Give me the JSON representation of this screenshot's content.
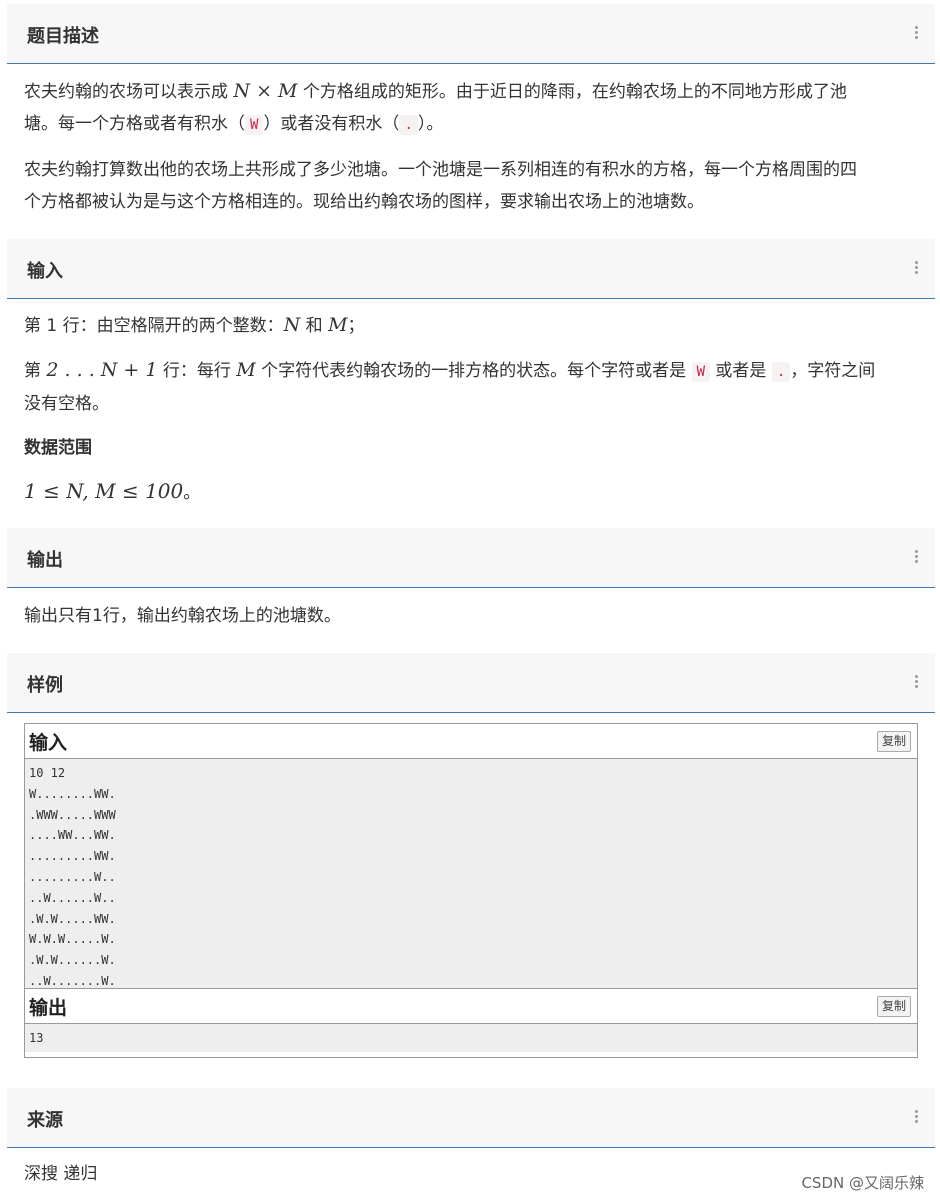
{
  "sections": {
    "description": {
      "title": "题目描述"
    },
    "input": {
      "title": "输入"
    },
    "output": {
      "title": "输出"
    },
    "sample": {
      "title": "样例"
    },
    "source": {
      "title": "来源"
    }
  },
  "description": {
    "p1_a": "农夫约翰的农场可以表示成 ",
    "p1_N": "N",
    "p1_times": " × ",
    "p1_M": "M",
    "p1_b": " 个方格组成的矩形。由于近日的降雨，在约翰农场上的不同地方形成了池",
    "p1_c": "塘。每一个方格或者有积水（",
    "p1_code_w": "W",
    "p1_d": "）或者没有积水（",
    "p1_code_dot": ".",
    "p1_e": "）。",
    "p2_a": "农夫约翰打算数出他的农场上共形成了多少池塘。一个池塘是一系列相连的有积水的方格，每一个方格周围的四",
    "p2_b": "个方格都被认为是与这个方格相连的。现给出约翰农场的图样，要求输出农场上的池塘数。"
  },
  "input_desc": {
    "l1_a": "第 1 行：由空格隔开的两个整数：",
    "l1_N": "N",
    "l1_b": " 和 ",
    "l1_M": "M",
    "l1_c": "；",
    "l2_a": "第 ",
    "l2_range": "2 . . . N + 1",
    "l2_b": " 行：每行 ",
    "l2_M": "M",
    "l2_c": " 个字符代表约翰农场的一排方格的状态。每个字符或者是 ",
    "l2_code_w": "W",
    "l2_d": " 或者是 ",
    "l2_code_dot": ".",
    "l2_e": "，字符之间",
    "l3": "没有空格。",
    "range_title": "数据范围",
    "range_expr": "1 ≤ N, M ≤ 100",
    "range_end": "。"
  },
  "output_desc": {
    "text": "输出只有1行，输出约翰农场上的池塘数。"
  },
  "sample": {
    "input_label": "输入",
    "output_label": "输出",
    "copy_label": "复制",
    "input_text": "10 12\nW........WW.\n.WWW.....WWW\n....WW...WW.\n.........WW.\n.........W..\n..W......W..\n.W.W.....WW.\nW.W.W.....W.\n.W.W......W.\n..W.......W.",
    "output_text": "13"
  },
  "source": {
    "text": "深搜 递归"
  },
  "watermark": "CSDN @又阔乐辣"
}
